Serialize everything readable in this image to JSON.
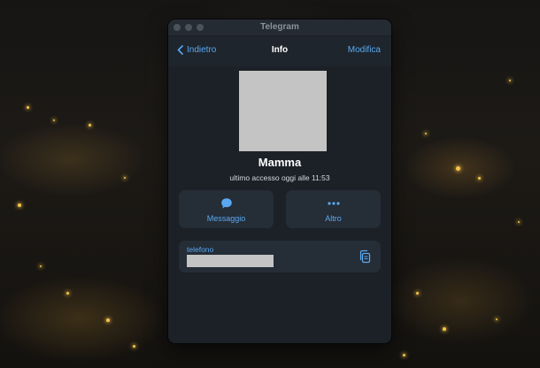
{
  "window": {
    "title": "Telegram"
  },
  "navbar": {
    "back_label": "Indietro",
    "title": "Info",
    "edit_label": "Modifica"
  },
  "profile": {
    "name": "Mamma",
    "status": "ultimo accesso oggi alle 11:53"
  },
  "actions": [
    {
      "label": "Messaggio",
      "icon": "chat-bubble-icon"
    },
    {
      "label": "Altro",
      "icon": "more-dots-icon"
    }
  ],
  "phone": {
    "label": "telefono",
    "copy_icon": "copy-icon"
  },
  "colors": {
    "accent": "#5aa9f0",
    "window_bg": "#1c2127",
    "card_bg": "#252d37",
    "redaction": "#c4c4c4"
  }
}
